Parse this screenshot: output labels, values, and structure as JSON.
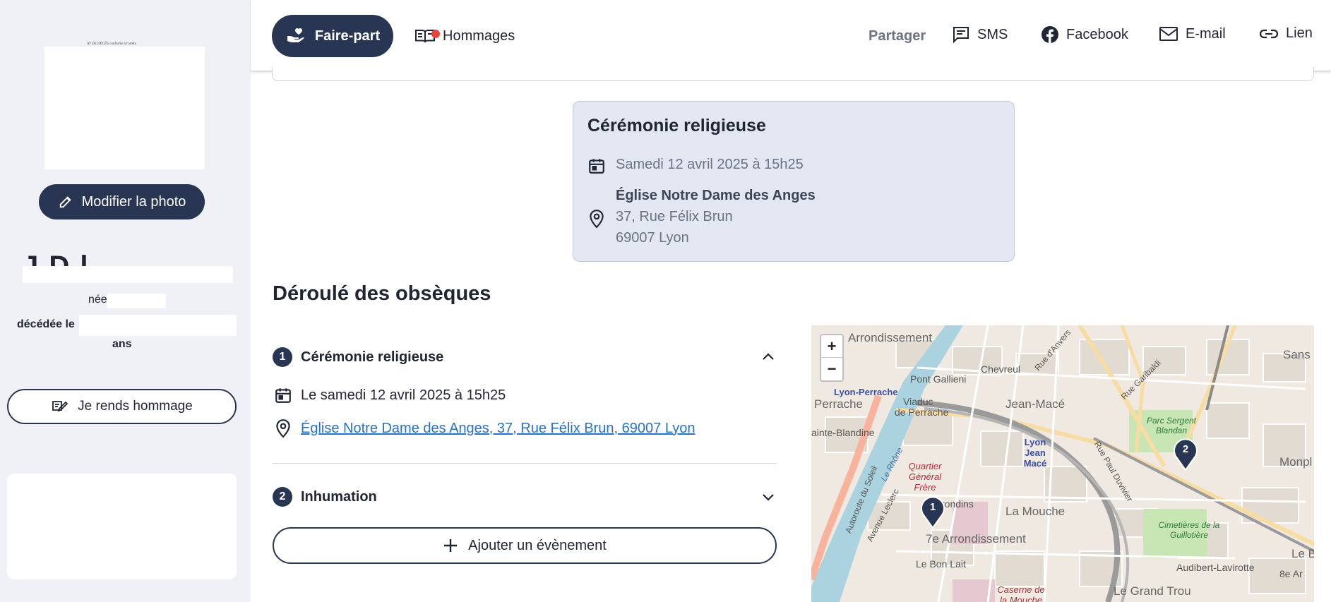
{
  "sidebar": {
    "photo_caption": "AT DE DÉCÈS conforme à l'arrête",
    "edit_photo_label": "Modifier la photo",
    "name": "J       D     l",
    "born_label": "née",
    "died_label": "décédée le",
    "age_label": "ans",
    "tribute_button_label": "Je rends hommage"
  },
  "topbar": {
    "tabs": [
      {
        "label": "Faire-part",
        "icon": "hand-heart-icon",
        "active": true
      },
      {
        "label": "Hommages",
        "icon": "open-book-icon",
        "active": false,
        "notification": true
      }
    ],
    "share_label": "Partager",
    "share_items": [
      {
        "label": "SMS",
        "icon": "message-icon"
      },
      {
        "label": "Facebook",
        "icon": "facebook-icon"
      },
      {
        "label": "E-mail",
        "icon": "mail-icon"
      },
      {
        "label": "Lien",
        "icon": "link-icon"
      }
    ]
  },
  "ceremony_card": {
    "title": "Cérémonie religieuse",
    "date": "Samedi 12 avril 2025 à 15h25",
    "place_name": "Église Notre Dame des Anges",
    "address_line1": "37, Rue Félix Brun",
    "address_line2": "69007 Lyon"
  },
  "obseques": {
    "title": "Déroulé des obsèques",
    "events": [
      {
        "number": "1",
        "title": "Cérémonie religieuse",
        "expanded": true,
        "date": "Le samedi 12 avril 2025 à 15h25",
        "location_link": "Église Notre Dame des Anges, 37, Rue Félix Brun, 69007 Lyon"
      },
      {
        "number": "2",
        "title": "Inhumation",
        "expanded": false
      }
    ],
    "add_event_label": "Ajouter un évènement"
  },
  "map": {
    "zoom_in": "+",
    "zoom_out": "−",
    "labels": {
      "arrondissement_top": "Arrondissement",
      "pont_gallieni": "Pont Gallieni",
      "chevreul": "Chevreul",
      "lyon_perrache": "Lyon-Perrache",
      "viaduc": "Viaduc",
      "de_perrache": "de Perrache",
      "perrache": "Perrache",
      "jean_mace": "Jean-Macé",
      "lyon_jean_mace": "Lyon Jean Macé",
      "sainte_blandine": "ainte-Blandine",
      "quartier": "Quartier Général Frère",
      "girondins": "Girondins",
      "la_mouche": "La Mouche",
      "seventh": "7e Arrondissement",
      "le_bon_lait": "Le Bon Lait",
      "parc_sergent": "Parc Sergent Blandan",
      "cimetieres": "Cimetières de la Guillotière",
      "audibert": "Audibert-Lavirotte",
      "le_grand_trou": "Le Grand Trou",
      "caserne": "Caserne de la Mouche",
      "sans_s": "Sans S",
      "monpl": "Monpl",
      "le_b": "Le B",
      "huitieme": "8e Ar",
      "rue_garibaldi": "Rue Garibaldi",
      "rhone": "Le Rhône",
      "autoroute": "Autoroute du Soleil",
      "avenue_leclerc": "Avenue Leclerc",
      "rue_anvers": "Rue d'Anvers",
      "rue_paul_duvivier": "Rue Paul Duvivier"
    },
    "markers": [
      "1",
      "2"
    ],
    "colors": {
      "river": "#aad3df",
      "road_major": "#f9b29c",
      "road_yellow": "#f7dca3",
      "park": "#c8e6b4",
      "marker": "#293653"
    }
  }
}
